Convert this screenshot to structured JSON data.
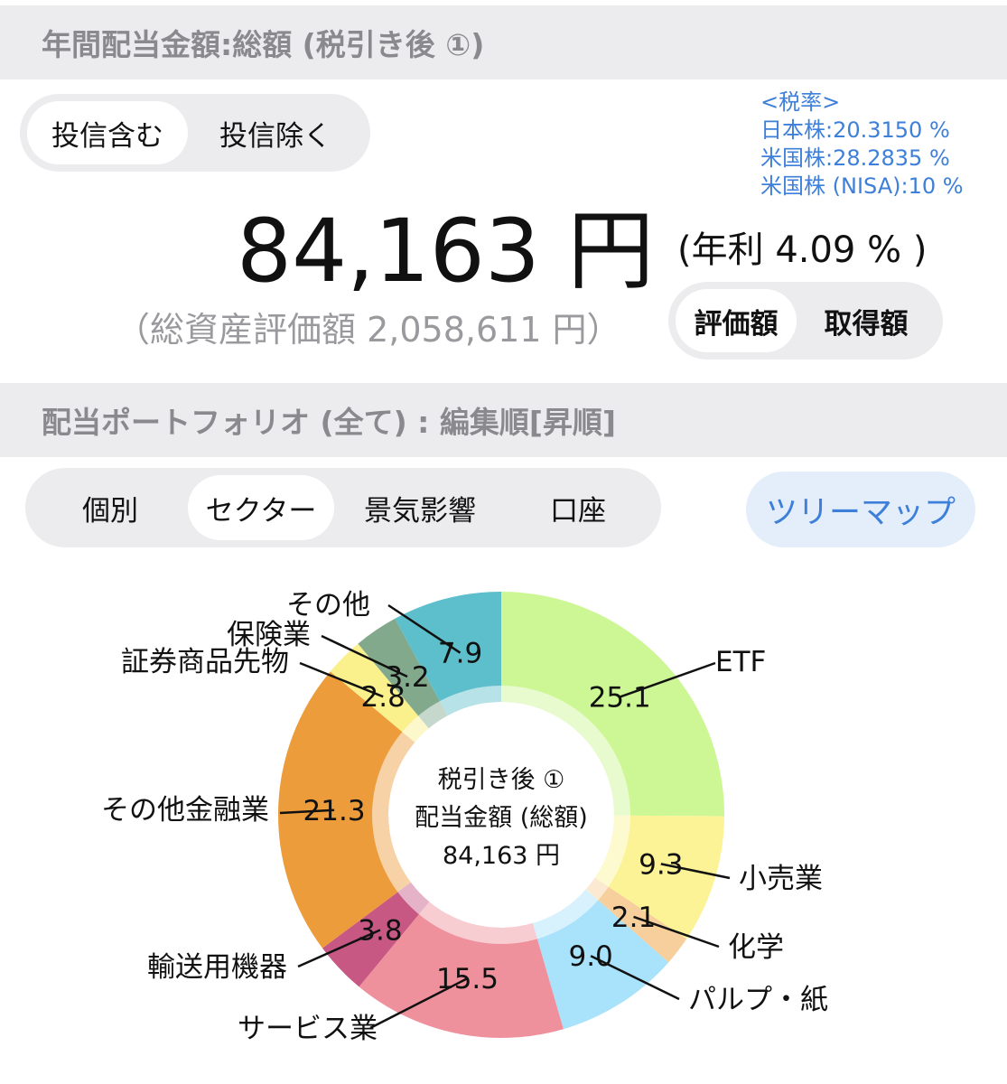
{
  "header_annual": {
    "title": "年間配当金額:総額 (税引き後 ①)"
  },
  "fund_toggle": {
    "include": "投信含む",
    "exclude": "投信除く"
  },
  "tax_rates": {
    "heading": "<税率>",
    "japan": "日本株:20.3150 %",
    "us": "米国株:28.2835 %",
    "us_nisa": "米国株 (NISA):10 %"
  },
  "summary": {
    "amount": "84,163 円",
    "yield": "(年利 4.09 % )",
    "asset": "（総資産評価額 2,058,611 円）"
  },
  "value_toggle": {
    "valuation": "評価額",
    "cost": "取得額"
  },
  "header_portfolio": {
    "title": "配当ポートフォリオ (全て) : 編集順[昇順]"
  },
  "tabs": {
    "individual": "個別",
    "sector": "セクター",
    "economy": "景気影響",
    "account": "口座"
  },
  "treemap_button": "ツリーマップ",
  "chart_data": {
    "type": "donut",
    "center": {
      "line1": "税引き後 ①",
      "line2": "配当金額 (総額)",
      "line3": "84,163 円"
    },
    "unit": "%",
    "slices": [
      {
        "label": "ETF",
        "value": 25.1,
        "value_label": "25.1",
        "color": "#cdf795"
      },
      {
        "label": "小売業",
        "value": 9.3,
        "value_label": "9.3",
        "color": "#fcf396"
      },
      {
        "label": "化学",
        "value": 2.1,
        "value_label": "2.1",
        "color": "#f6cf9c"
      },
      {
        "label": "パルプ・紙",
        "value": 9.0,
        "value_label": "9.0",
        "color": "#a8e2fb"
      },
      {
        "label": "サービス業",
        "value": 15.5,
        "value_label": "15.5",
        "color": "#ee919c"
      },
      {
        "label": "輸送用機器",
        "value": 3.8,
        "value_label": "3.8",
        "color": "#c65883"
      },
      {
        "label": "その他金融業",
        "value": 21.3,
        "value_label": "21.3",
        "color": "#ec9c3a"
      },
      {
        "label": "証券商品先物",
        "value": 2.8,
        "value_label": "2.8",
        "color": "#faf08c"
      },
      {
        "label": "保険業",
        "value": 3.2,
        "value_label": "3.2",
        "color": "#82a98c"
      },
      {
        "label": "その他",
        "value": 7.9,
        "value_label": "7.9",
        "color": "#5ebfcc"
      }
    ]
  }
}
